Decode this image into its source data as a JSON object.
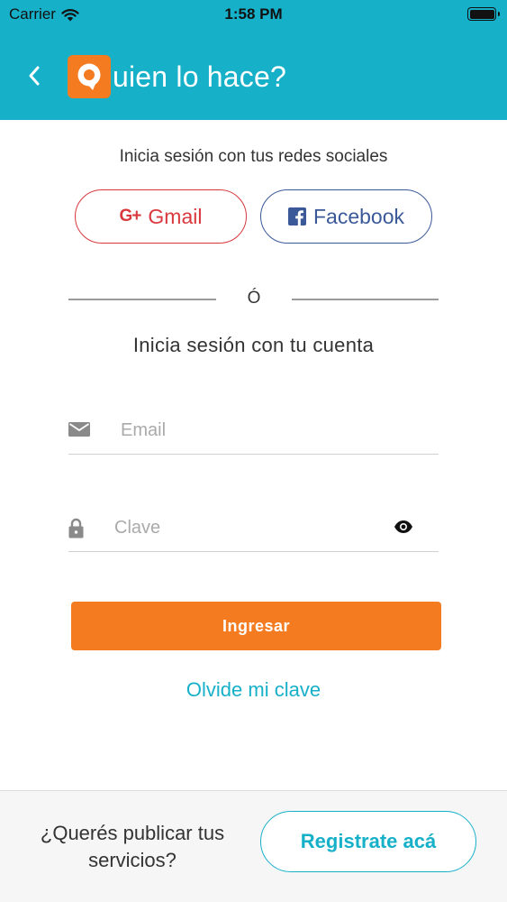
{
  "status_bar": {
    "carrier": "Carrier",
    "time": "1:58 PM"
  },
  "header": {
    "title": "uien lo hace?",
    "logo_letter": "Q"
  },
  "social": {
    "heading": "Inicia sesión con tus redes sociales",
    "gmail_icon": "G+",
    "gmail_label": "Gmail",
    "facebook_label": "Facebook"
  },
  "divider": {
    "text": "Ó"
  },
  "login": {
    "heading": "Inicia sesión con tu cuenta",
    "email_placeholder": "Email",
    "email_value": "",
    "password_placeholder": "Clave",
    "password_value": "",
    "submit_label": "Ingresar",
    "forgot_label": "Olvide mi clave"
  },
  "footer": {
    "text": "¿Querés publicar tus servicios?",
    "register_label": "Registrate acá"
  },
  "colors": {
    "header": "#17b0c9",
    "accent": "#f47b20",
    "gmail": "#d9393e",
    "facebook": "#3b5998"
  },
  "icons": {
    "back": "chevron-left-icon",
    "wifi": "wifi-icon",
    "battery": "battery-icon",
    "gmail": "google-plus-icon",
    "facebook": "facebook-icon",
    "email": "envelope-icon",
    "password": "lock-icon",
    "show_password": "eye-icon"
  }
}
